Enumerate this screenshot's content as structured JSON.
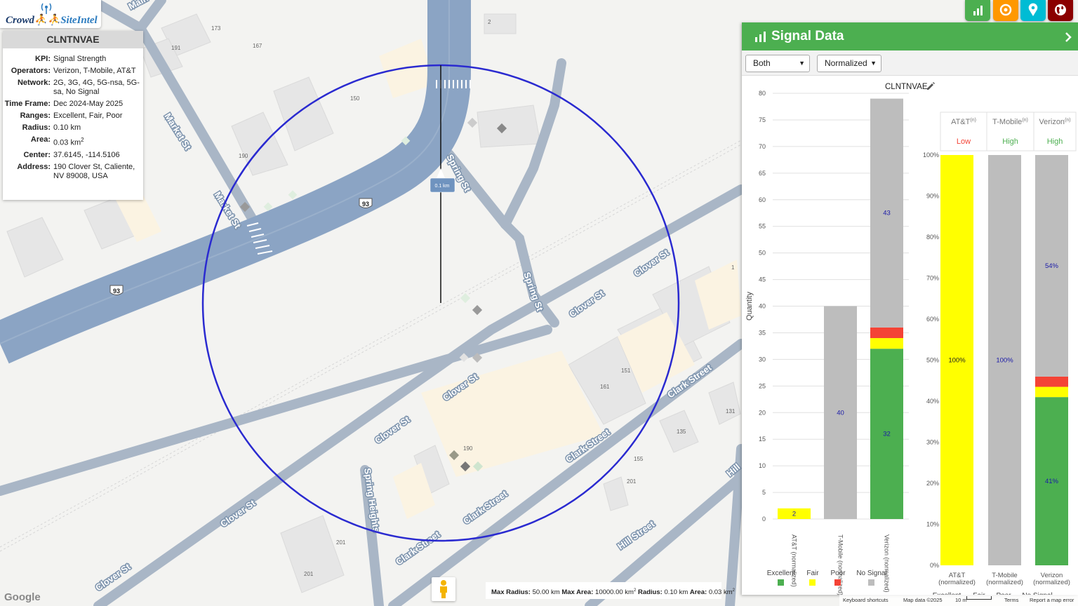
{
  "logo": {
    "text_a": "Crowd",
    "text_b": "SiteIntel"
  },
  "info": {
    "title": "CLNTNVAE",
    "rows": [
      {
        "k": "KPI:",
        "v": "Signal Strength"
      },
      {
        "k": "Operators:",
        "v": "Verizon, T-Mobile, AT&T"
      },
      {
        "k": "Network:",
        "v": "2G, 3G, 4G, 5G-nsa, 5G-sa, No Signal"
      },
      {
        "k": "Time Frame:",
        "v": "Dec 2024-May 2025"
      },
      {
        "k": "Ranges:",
        "v": "Excellent, Fair, Poor"
      },
      {
        "k": "Radius:",
        "v": "0.10 km"
      },
      {
        "k": "Area:",
        "v": "0.03 km",
        "sup": "2"
      },
      {
        "k": "Center:",
        "v": "37.6145, -114.5106"
      },
      {
        "k": "Address:",
        "v": "190 Clover St, Caliente, NV 89008, USA"
      }
    ]
  },
  "toolbar": {
    "buttons": [
      {
        "name": "chart-button",
        "icon": "bar-chart-icon",
        "color": "#4caf50"
      },
      {
        "name": "target-button",
        "icon": "target-icon",
        "color": "#ff9800"
      },
      {
        "name": "location-button",
        "icon": "map-pin-icon",
        "color": "#00bcd4"
      },
      {
        "name": "globe-button",
        "icon": "globe-icon",
        "color": "#8b0000"
      }
    ]
  },
  "panel": {
    "title": "Signal Data",
    "operator_select": "Both",
    "mode_select": "Normalized",
    "chart_title": "CLNTNVAE"
  },
  "colors": {
    "excellent": "#4caf50",
    "fair": "#ffff00",
    "poor": "#f44336",
    "no_signal": "#bdbdbd",
    "circle": "#2222cc"
  },
  "map": {
    "radius_label": "0.1 km",
    "road_labels": [
      "Spring St",
      "Spring St",
      "Market St",
      "Market St",
      "Clover St",
      "Clover St",
      "Clover St",
      "Clover St",
      "Clover St",
      "Clover St",
      "Clark Street",
      "Clark Street",
      "Clark Street",
      "Clark Street",
      "Hill Street",
      "Spring Heights",
      "Main",
      "Hill"
    ],
    "shields": [
      "93",
      "93"
    ],
    "building_numbers": [
      "173",
      "191",
      "167",
      "150",
      "190",
      "2",
      "151",
      "161",
      "131",
      "135",
      "190",
      "155",
      "201",
      "201",
      "201",
      "1"
    ]
  },
  "bottom": {
    "max_radius_k": "Max Radius:",
    "max_radius_v": "50.00 km",
    "max_area_k": "Max Area:",
    "max_area_v": "10000.00 km",
    "radius_k": "Radius:",
    "radius_v": "0.10 km",
    "area_k": "Area:",
    "area_v": "0.03 km",
    "sup": "2",
    "google": "Google",
    "keyboard": "Keyboard shortcuts",
    "mapdata": "Map data ©2025",
    "scale": "10 m",
    "terms": "Terms",
    "report": "Report a map error"
  },
  "chart_data": [
    {
      "type": "bar",
      "title": "CLNTNVAE",
      "ylabel": "Quantity",
      "categories": [
        "AT&T (normalized)",
        "T-Mobile (normalized)",
        "Verizon (normalized)"
      ],
      "ylim": [
        0,
        80
      ],
      "yticks": [
        0,
        5,
        10,
        15,
        20,
        25,
        30,
        35,
        40,
        45,
        50,
        55,
        60,
        65,
        70,
        75,
        80
      ],
      "series": [
        {
          "name": "Excellent",
          "values": [
            0,
            0,
            32
          ]
        },
        {
          "name": "Fair",
          "values": [
            2,
            0,
            2
          ]
        },
        {
          "name": "Poor",
          "values": [
            0,
            0,
            2
          ]
        },
        {
          "name": "No Signal",
          "values": [
            0,
            40,
            43
          ]
        }
      ],
      "data_labels": [
        {
          "cat": 0,
          "series": "Fair",
          "text": "2"
        },
        {
          "cat": 1,
          "series": "No Signal",
          "text": "40"
        },
        {
          "cat": 2,
          "series": "Excellent",
          "text": "32"
        },
        {
          "cat": 2,
          "series": "No Signal",
          "text": "43"
        }
      ],
      "legend": [
        "Excellent",
        "Fair",
        "Poor",
        "No Signal"
      ],
      "legend_position": "bottom"
    },
    {
      "type": "bar",
      "stacked_percent": true,
      "categories": [
        "AT&T (normalized)",
        "T-Mobile (normalized)",
        "Verizon (normalized)"
      ],
      "headers": [
        "AT&T",
        "T-Mobile",
        "Verizon"
      ],
      "header_sup": "(n)",
      "ratings": [
        "Low",
        "High",
        "High"
      ],
      "rating_colors": [
        "#f44336",
        "#4caf50",
        "#4caf50"
      ],
      "ylim": [
        0,
        100
      ],
      "yticks": [
        "0%",
        "10%",
        "20%",
        "30%",
        "40%",
        "50%",
        "60%",
        "70%",
        "80%",
        "90%",
        "100%"
      ],
      "series": [
        {
          "name": "Excellent",
          "values": [
            0,
            0,
            41
          ]
        },
        {
          "name": "Fair",
          "values": [
            100,
            0,
            2.5
          ]
        },
        {
          "name": "Poor",
          "values": [
            0,
            0,
            2.5
          ]
        },
        {
          "name": "No Signal",
          "values": [
            0,
            100,
            54
          ]
        }
      ],
      "data_labels": [
        {
          "cat": 0,
          "series": "Fair",
          "text": "100%"
        },
        {
          "cat": 1,
          "series": "No Signal",
          "text": "100%"
        },
        {
          "cat": 2,
          "series": "Excellent",
          "text": "41%"
        },
        {
          "cat": 2,
          "series": "No Signal",
          "text": "54%"
        }
      ],
      "legend": [
        "Excellent",
        "Fair",
        "Poor",
        "No Signal"
      ],
      "legend_position": "bottom"
    }
  ]
}
